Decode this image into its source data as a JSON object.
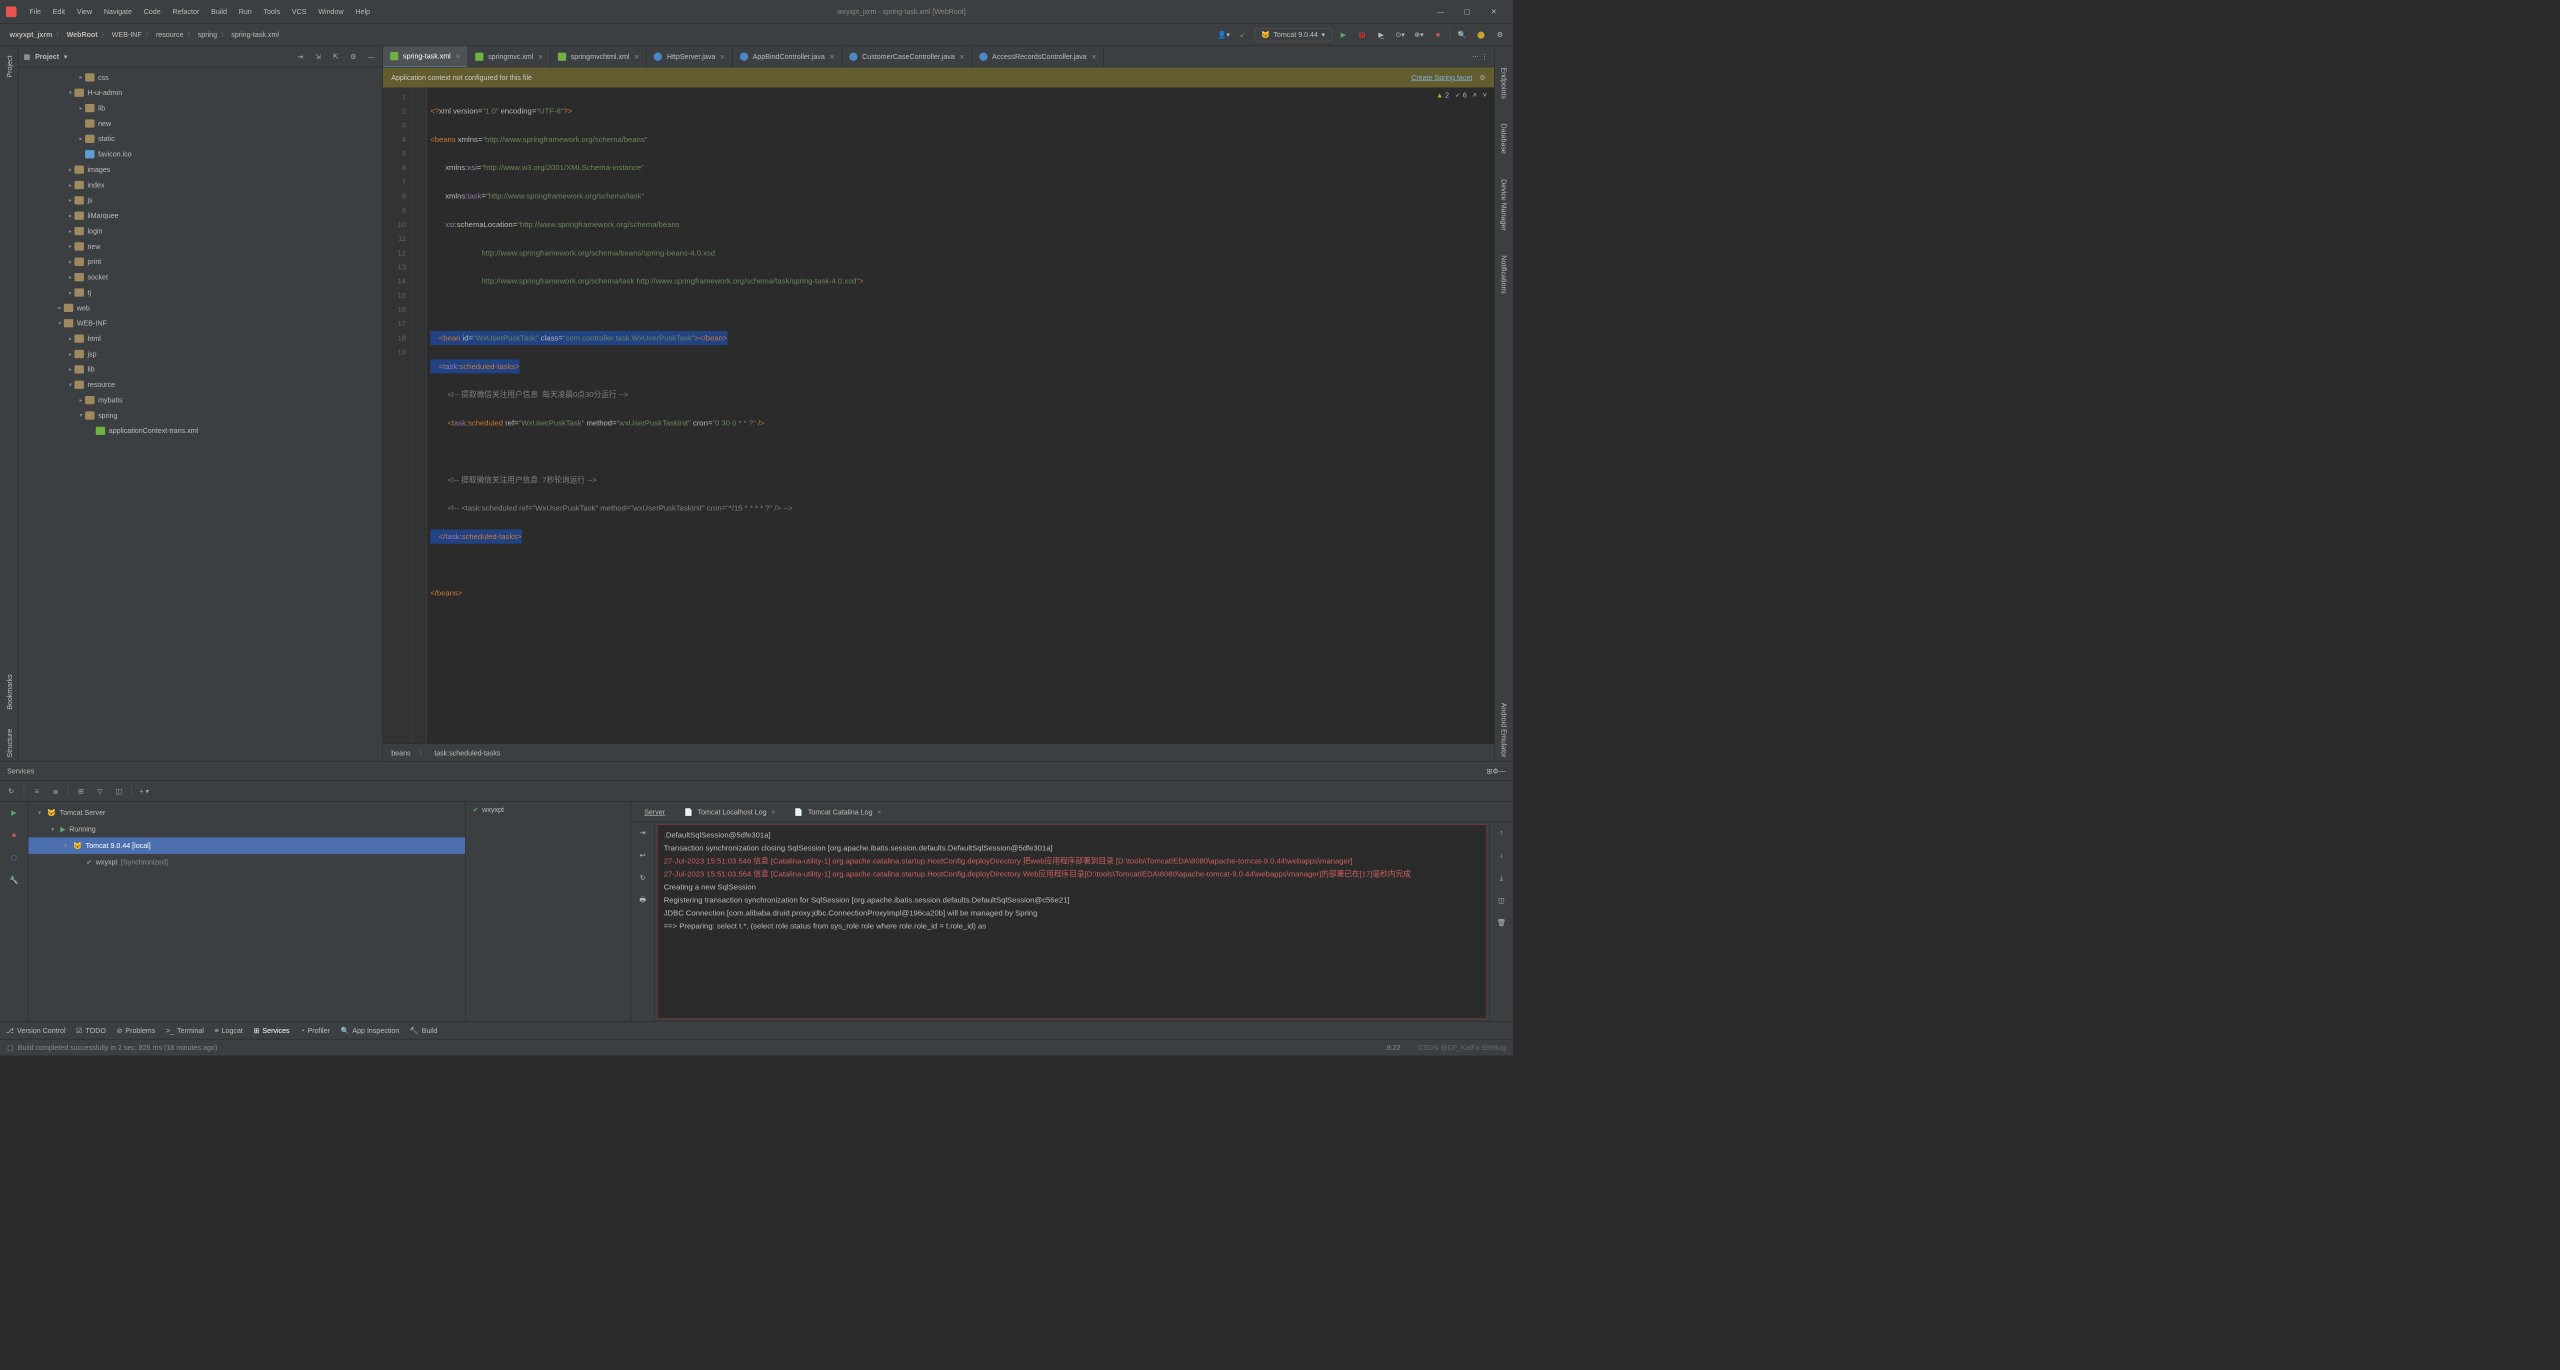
{
  "menu": [
    "File",
    "Edit",
    "View",
    "Navigate",
    "Code",
    "Refactor",
    "Build",
    "Run",
    "Tools",
    "VCS",
    "Window",
    "Help"
  ],
  "window_title": "wxyxpt_jxrm - spring-task.xml [WebRoot]",
  "breadcrumbs": [
    "wxyxpt_jxrm",
    "WebRoot",
    "WEB-INF",
    "resource",
    "spring",
    "spring-task.xml"
  ],
  "run_config": "Tomcat 9.0.44",
  "project": {
    "title": "Project",
    "items": [
      {
        "indent": 5,
        "chev": "▸",
        "icon": "folder",
        "label": "css"
      },
      {
        "indent": 4,
        "chev": "▾",
        "icon": "folder",
        "label": "H-ui-admin"
      },
      {
        "indent": 5,
        "chev": "▸",
        "icon": "folder",
        "label": "lib"
      },
      {
        "indent": 5,
        "chev": "",
        "icon": "folder",
        "label": "new"
      },
      {
        "indent": 5,
        "chev": "▸",
        "icon": "folder",
        "label": "static"
      },
      {
        "indent": 5,
        "chev": "",
        "icon": "file",
        "label": "favicon.ico"
      },
      {
        "indent": 4,
        "chev": "▸",
        "icon": "folder",
        "label": "images"
      },
      {
        "indent": 4,
        "chev": "▸",
        "icon": "folder",
        "label": "index"
      },
      {
        "indent": 4,
        "chev": "▸",
        "icon": "folder",
        "label": "js"
      },
      {
        "indent": 4,
        "chev": "▸",
        "icon": "folder",
        "label": "liMarquee"
      },
      {
        "indent": 4,
        "chev": "▸",
        "icon": "folder",
        "label": "login"
      },
      {
        "indent": 4,
        "chev": "▸",
        "icon": "folder",
        "label": "new"
      },
      {
        "indent": 4,
        "chev": "▸",
        "icon": "folder",
        "label": "print"
      },
      {
        "indent": 4,
        "chev": "▸",
        "icon": "folder",
        "label": "socket"
      },
      {
        "indent": 4,
        "chev": "▸",
        "icon": "folder",
        "label": "tj"
      },
      {
        "indent": 3,
        "chev": "▸",
        "icon": "folder",
        "label": "web"
      },
      {
        "indent": 3,
        "chev": "▾",
        "icon": "folder",
        "label": "WEB-INF"
      },
      {
        "indent": 4,
        "chev": "▸",
        "icon": "folder",
        "label": "html"
      },
      {
        "indent": 4,
        "chev": "▸",
        "icon": "folder",
        "label": "jsp"
      },
      {
        "indent": 4,
        "chev": "▸",
        "icon": "folder",
        "label": "lib"
      },
      {
        "indent": 4,
        "chev": "▾",
        "icon": "folder",
        "label": "resource"
      },
      {
        "indent": 5,
        "chev": "▸",
        "icon": "folder",
        "label": "mybatis"
      },
      {
        "indent": 5,
        "chev": "▾",
        "icon": "folder",
        "label": "spring"
      },
      {
        "indent": 6,
        "chev": "",
        "icon": "spring",
        "label": "applicationContext-trans.xml"
      }
    ]
  },
  "tabs": [
    {
      "label": "spring-task.xml",
      "icon": "spring",
      "active": true
    },
    {
      "label": "springmvc.xml",
      "icon": "spring"
    },
    {
      "label": "springmvchtml.xml",
      "icon": "spring"
    },
    {
      "label": "HttpServer.java",
      "icon": "java"
    },
    {
      "label": "AppBindController.java",
      "icon": "java"
    },
    {
      "label": "CustomerCaseController.java",
      "icon": "java"
    },
    {
      "label": "AccessRecordsController.java",
      "icon": "java"
    }
  ],
  "banner": {
    "text": "Application context not configured for this file",
    "link": "Create Spring facet"
  },
  "inspections": {
    "warnings": "2",
    "oks": "6"
  },
  "code_lines": [
    "1",
    "2",
    "3",
    "4",
    "5",
    "6",
    "7",
    "8",
    "9",
    "10",
    "11",
    "12",
    "13",
    "14",
    "15",
    "16",
    "17",
    "18",
    "19"
  ],
  "code": {
    "l1a": "<?",
    "l1b": "xml version",
    "l1c": "=",
    "l1d": "\"1.0\"",
    "l1e": " encoding",
    "l1f": "=",
    "l1g": "\"UTF-8\"",
    "l1h": "?>",
    "l2a": "<beans ",
    "l2b": "xmlns",
    "l2c": "=",
    "l2d": "\"http://www.springframework.org/schema/beans\"",
    "l3a": "       xmlns:",
    "l3b": "xsi",
    "l3c": "=",
    "l3d": "\"http://www.w3.org/2001/XMLSchema-instance\"",
    "l4a": "       xmlns:",
    "l4b": "task",
    "l4c": "=",
    "l4d": "\"http://www.springframework.org/schema/task\"",
    "l5a": "       xsi",
    "l5b": ":schemaLocation",
    "l5c": "=",
    "l5d": "\"http://www.springframework.org/schema/beans",
    "l6": "                        http://www.springframework.org/schema/beans/spring-beans-4.0.xsd",
    "l7": "                        http://www.springframework.org/schema/task http://www.springframework.org/schema/task/spring-task-4.0.xsd\"",
    "l7b": ">",
    "l9a": "    <bean ",
    "l9b": "id",
    "l9c": "=",
    "l9d": "\"WxUserPuskTask\"",
    "l9e": " class",
    "l9f": "=",
    "l9g": "\"com.controller.task.WxUserPuskTask\"",
    "l9h": "></bean>",
    "l10a": "    <",
    "l10b": "task",
    "l10c": ":scheduled-tasks>",
    "l11": "        <!-- 提取微信关注用户信息  每天凌晨0点30分运行 -->",
    "l12a": "        <",
    "l12b": "task",
    "l12c": ":scheduled ",
    "l12d": "ref",
    "l12e": "=",
    "l12f": "\"WxUserPuskTask\"",
    "l12g": " method",
    "l12h": "=",
    "l12i": "\"wxUserPuskTaskInit\"",
    "l12j": " cron",
    "l12k": "=",
    "l12l": "\"0 30 0 * * ?\"",
    "l12m": " />",
    "l14": "        <!-- 提取微信关注用户信息  7秒轮询运行 -->",
    "l15": "        <!-- <task:scheduled ref=\"WxUserPuskTask\" method=\"wxUserPuskTaskInit\" cron=\"*/15 * * * * ?\" /> -->",
    "l16a": "    </",
    "l16b": "task",
    "l16c": ":scheduled-tasks>",
    "l18": "</beans>"
  },
  "code_breadcrumb": [
    "beans",
    "task:scheduled-tasks"
  ],
  "services": {
    "title": "Services",
    "tree": [
      {
        "indent": 0,
        "chev": "▾",
        "label": "Tomcat Server",
        "icon": "tomcat"
      },
      {
        "indent": 1,
        "chev": "▾",
        "label": "Running",
        "icon": "play"
      },
      {
        "indent": 2,
        "chev": "▾",
        "label": "Tomcat 9.0.44 [local]",
        "icon": "tomcat",
        "selected": true
      },
      {
        "indent": 3,
        "chev": "",
        "label": "wxyxpt",
        "suffix": "[Synchronized]",
        "icon": "artifact"
      }
    ],
    "mid_status": "wxyxpt",
    "tabs": [
      {
        "label": "Server",
        "active": true
      },
      {
        "label": "Tomcat Localhost Log",
        "closable": true
      },
      {
        "label": "Tomcat Catalina Log",
        "closable": true
      }
    ],
    "console": [
      {
        "cls": "white",
        "text": ".DefaultSqlSession@5dfe301a]"
      },
      {
        "cls": "white",
        "text": "Transaction synchronization closing SqlSession [org.apache.ibatis.session.defaults.DefaultSqlSession@5dfe301a]"
      },
      {
        "cls": "red",
        "text": "27-Jul-2023 15:51:03.546 信息 [Catalina-utility-1] org.apache.catalina.startup.HostConfig.deployDirectory 把web应用程序部署到目录 [D:\\tools\\TomcatIEDA\\8080\\apache-tomcat-9.0.44\\webapps\\manager]"
      },
      {
        "cls": "red",
        "text": "27-Jul-2023 15:51:03.564 信息 [Catalina-utility-1] org.apache.catalina.startup.HostConfig.deployDirectory Web应用程序目录[D:\\tools\\TomcatIEDA\\8080\\apache-tomcat-9.0.44\\webapps\\manager]的部署已在[17]毫秒内完成"
      },
      {
        "cls": "white",
        "text": "Creating a new SqlSession"
      },
      {
        "cls": "white",
        "text": "Registering transaction synchronization for SqlSession [org.apache.ibatis.session.defaults.DefaultSqlSession@c56e21]"
      },
      {
        "cls": "white",
        "text": "JDBC Connection [com.alibaba.druid.proxy.jdbc.ConnectionProxyImpl@196ca20b] will be managed by Spring"
      },
      {
        "cls": "white",
        "text": "==>  Preparing: select t.*, (select role.status from sys_role role where role.role_id = t.role_id) as"
      }
    ]
  },
  "bottom_tools": [
    {
      "icon": "vcs",
      "label": "Version Control"
    },
    {
      "icon": "todo",
      "label": "TODO"
    },
    {
      "icon": "problems",
      "label": "Problems"
    },
    {
      "icon": "terminal",
      "label": "Terminal"
    },
    {
      "icon": "logcat",
      "label": "Logcat"
    },
    {
      "icon": "services",
      "label": "Services",
      "active": true
    },
    {
      "icon": "profiler",
      "label": "Profiler"
    },
    {
      "icon": "appinsp",
      "label": "App Inspection"
    },
    {
      "icon": "build",
      "label": "Build"
    }
  ],
  "status": {
    "msg": "Build completed successfully in 2 sec, 825 ms (18 minutes ago)",
    "pos": "8:22",
    "watermark": "CSDN @CF_KaiFa 999Bug"
  },
  "left_tools": [
    "Project",
    "Bookmarks",
    "Structure"
  ],
  "right_tools": [
    "Endpoints",
    "Database",
    "Device Manager",
    "Notifications",
    "Android Emulator"
  ]
}
